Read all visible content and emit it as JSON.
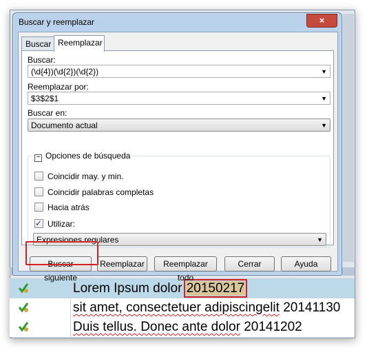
{
  "dialog": {
    "title": "Buscar y reemplazar",
    "close_glyph": "×",
    "tabs": [
      {
        "label": "Buscar",
        "active": false
      },
      {
        "label": "Reemplazar",
        "active": true
      }
    ],
    "find_label": "Buscar:",
    "find_value": "(\\d{4})(\\d{2})(\\d{2})",
    "replace_label": "Reemplazar por:",
    "replace_value": "$3$2$1",
    "search_in_label": "Buscar en:",
    "search_in_value": "Documento actual",
    "options_heading": "Opciones de búsqueda",
    "options": [
      {
        "label": "Coincidir may. y min.",
        "checked": false
      },
      {
        "label": "Coincidir palabras completas",
        "checked": false
      },
      {
        "label": "Hacia atrás",
        "checked": false
      },
      {
        "label": "Utilizar:",
        "checked": true
      }
    ],
    "use_value": "Expresiones regulares",
    "buttons": {
      "find_next": "Buscar siguiente",
      "replace": "Reemplazar",
      "replace_all": "Reemplazar todo",
      "close": "Cerrar",
      "help": "Ayuda"
    },
    "highlight_color": "#d32020"
  },
  "segments": [
    {
      "text": "Lorem Ipsum dolor",
      "number": "20150217",
      "selected": true
    },
    {
      "text": "sit amet, consectetuer adipiscingelit",
      "number": "20141130",
      "selected": false
    },
    {
      "text": "Duis tellus. Donec ante dolor",
      "number": "20141202",
      "selected": false
    }
  ],
  "icons": [
    "status-ok-icon",
    "checkmark-icon",
    "dropdown-arrow-icon",
    "collapse-icon"
  ]
}
